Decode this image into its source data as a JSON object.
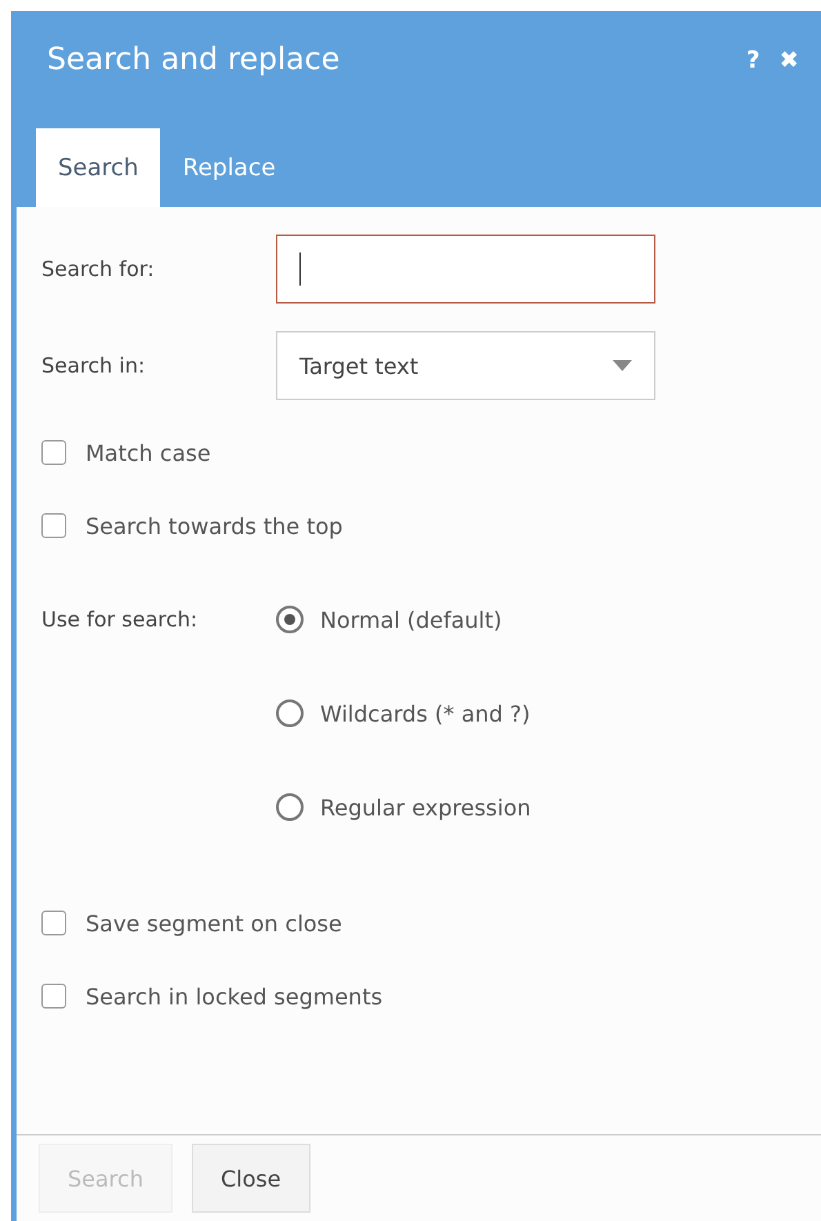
{
  "window": {
    "title": "Search and replace",
    "help": "?",
    "close": "✖"
  },
  "tabs": [
    {
      "label": "Search",
      "selected": true
    },
    {
      "label": "Replace",
      "selected": false
    }
  ],
  "search_for": {
    "label": "Search for:",
    "focused": true
  },
  "search_in": {
    "label": "Search in:",
    "value": "Target text"
  },
  "options_top": [
    {
      "label": "Match case",
      "checked": false
    },
    {
      "label": "Search towards the top",
      "checked": false
    }
  ],
  "use_for_search": {
    "label": "Use for search:",
    "options": [
      {
        "label": "Normal (default)",
        "selected": true
      },
      {
        "label": "Wildcards (* and ?)",
        "selected": false
      },
      {
        "label": "Regular expression",
        "selected": false
      }
    ]
  },
  "options_bottom": [
    {
      "label": "Save segment on close",
      "checked": false
    },
    {
      "label": "Search in locked segments",
      "checked": false
    }
  ],
  "buttons": [
    {
      "label": "Search",
      "disabled": true
    },
    {
      "label": "Close",
      "disabled": false
    }
  ]
}
